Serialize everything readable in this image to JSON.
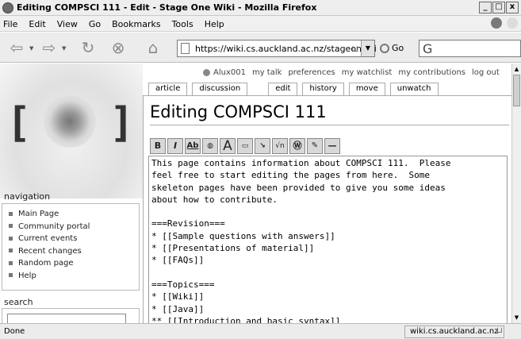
{
  "window": {
    "title": "Editing COMPSCI 111 - Edit - Stage One Wiki - Mozilla Firefox",
    "controls": [
      "_",
      "□",
      "x"
    ]
  },
  "menubar": [
    "File",
    "Edit",
    "View",
    "Go",
    "Bookmarks",
    "Tools",
    "Help"
  ],
  "navbar": {
    "url": "https://wiki.cs.auckland.ac.nz/stageonewi",
    "go_label": "Go",
    "search_glyph": "G"
  },
  "personal": {
    "user": "Alux001",
    "links": [
      "my talk",
      "preferences",
      "my watchlist",
      "my contributions",
      "log out"
    ]
  },
  "tabs": {
    "left": [
      "article",
      "discussion"
    ],
    "right": [
      "edit",
      "history",
      "move",
      "unwatch"
    ]
  },
  "heading": "Editing COMPSCI 111",
  "toolbar": [
    "B",
    "I",
    "Ab",
    "link",
    "A",
    "img",
    "med",
    "√n",
    "W",
    "sig",
    "—"
  ],
  "editor_text": "This page contains information about COMPSCI 111.  Please\nfeel free to start editing the pages from here.  Some\nskeleton pages have been provided to give you some ideas\nabout how to contribute.\n\n===Revision===\n* [[Sample questions with answers]]\n* [[Presentations of material]]\n* [[FAQs]]\n\n===Topics===\n* [[Wiki]]\n* [[Java]]\n** [[Introduction and basic syntax]]",
  "sidebar": {
    "navigation_title": "navigation",
    "items": [
      "Main Page",
      "Community portal",
      "Current events",
      "Recent changes",
      "Random page",
      "Help"
    ],
    "search_title": "search"
  },
  "statusbar": {
    "status": "Done",
    "host": "wiki.cs.auckland.ac.nz"
  }
}
